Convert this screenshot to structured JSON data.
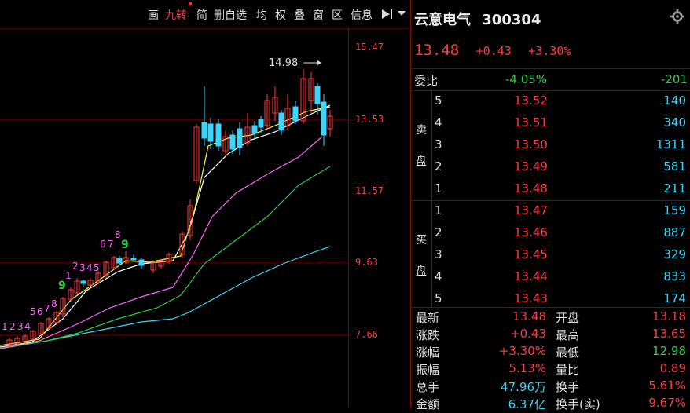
{
  "toolbar": {
    "items": [
      "画",
      "九转",
      "简",
      "删自选",
      "均",
      "权",
      "叠",
      "窗",
      "区",
      "信息"
    ],
    "active": "九转",
    "play_icon": "play-next-icon",
    "menu_icon": "dropdown-arrow-icon"
  },
  "chart": {
    "price_ticks": [
      "15.47",
      "13.53",
      "11.57",
      "9.63",
      "7.66"
    ],
    "high_label": "14.98",
    "nine_turn": {
      "sequence_a": [
        "1",
        "2",
        "3",
        "4",
        "5",
        "6",
        "7",
        "8",
        "9"
      ],
      "sequence_b": [
        "1",
        "2",
        "3",
        "4",
        "5",
        "6",
        "7",
        "8",
        "9"
      ]
    }
  },
  "stock": {
    "name": "云意电气",
    "code": "300304",
    "price": "13.48",
    "change": "+0.43",
    "pct": "+3.30%"
  },
  "weibi": {
    "label": "委比",
    "pct": "-4.05%",
    "diff": "-201"
  },
  "orderbook": {
    "sell_label_1": "卖",
    "sell_label_2": "盘",
    "buy_label_1": "买",
    "buy_label_2": "盘",
    "sell": [
      {
        "lvl": "5",
        "price": "13.52",
        "vol": "140"
      },
      {
        "lvl": "4",
        "price": "13.51",
        "vol": "340"
      },
      {
        "lvl": "3",
        "price": "13.50",
        "vol": "1311"
      },
      {
        "lvl": "2",
        "price": "13.49",
        "vol": "581"
      },
      {
        "lvl": "1",
        "price": "13.48",
        "vol": "211"
      }
    ],
    "buy": [
      {
        "lvl": "1",
        "price": "13.47",
        "vol": "159"
      },
      {
        "lvl": "2",
        "price": "13.46",
        "vol": "887"
      },
      {
        "lvl": "3",
        "price": "13.45",
        "vol": "329"
      },
      {
        "lvl": "4",
        "price": "13.44",
        "vol": "833"
      },
      {
        "lvl": "5",
        "price": "13.43",
        "vol": "174"
      }
    ]
  },
  "stats": [
    {
      "k1": "最新",
      "v1": "13.48",
      "c1": "r",
      "k2": "开盘",
      "v2": "13.18",
      "c2": "r"
    },
    {
      "k1": "涨跌",
      "v1": "+0.43",
      "c1": "r",
      "k2": "最高",
      "v2": "13.65",
      "c2": "r"
    },
    {
      "k1": "涨幅",
      "v1": "+3.30%",
      "c1": "r",
      "k2": "最低",
      "v2": "12.98",
      "c2": "g"
    },
    {
      "k1": "振幅",
      "v1": "5.13%",
      "c1": "r",
      "k2": "量比",
      "v2": "0.89",
      "c2": "r"
    },
    {
      "k1": "总手",
      "v1": "47.96万",
      "c1": "c",
      "k2": "换手",
      "v2": "5.61%",
      "c2": "r"
    },
    {
      "k1": "金额",
      "v1": "6.37亿",
      "c1": "c",
      "k2": "换手(实)",
      "v2": "9.67%",
      "c2": "r"
    }
  ],
  "colors": {
    "up": "#ff3b3b",
    "down": "#3ad6ff",
    "green": "#2ecc40",
    "border": "#8b0000"
  }
}
